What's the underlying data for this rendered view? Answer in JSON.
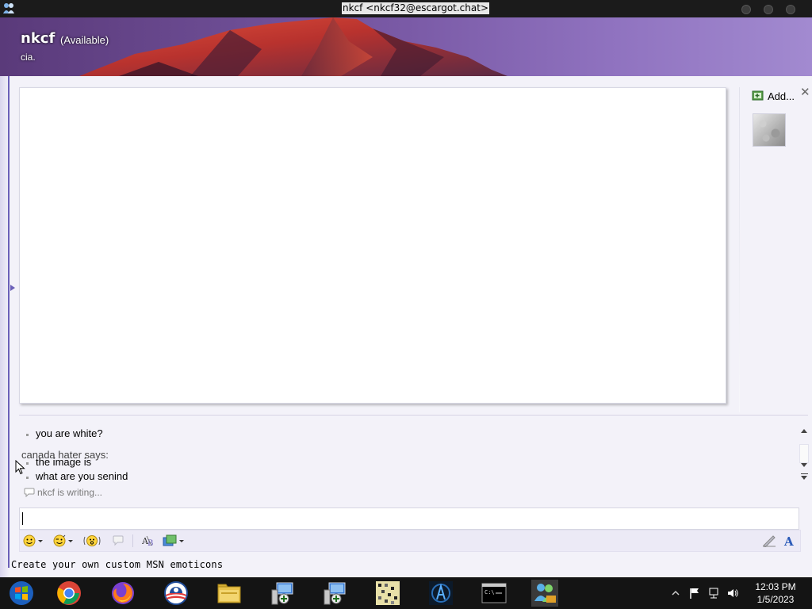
{
  "window": {
    "title": "nkcf <nkcf32@escargot.chat>"
  },
  "contact": {
    "name": "nkcf",
    "status": "(Available)",
    "personal_message": "cia."
  },
  "sidebar": {
    "add_label": "Add..."
  },
  "conversation": {
    "messages": [
      {
        "text": "you are white?"
      },
      {
        "sender": "canada hater says:"
      },
      {
        "text": "the image is"
      },
      {
        "text": "what are you senind"
      }
    ],
    "typing_status": "nkcf is writing..."
  },
  "input": {
    "value": ""
  },
  "footer": {
    "link_text": "Create your own custom MSN emoticons"
  },
  "taskbar": {
    "apps": [
      "windows-start-icon",
      "chrome-icon",
      "firefox-icon",
      "obama-logo-icon",
      "file-explorer-icon",
      "network-setup-icon",
      "network-setup-2-icon",
      "pixel-art-icon",
      "dark-app-icon",
      "command-prompt-icon",
      "msn-messenger-icon"
    ],
    "clock_time": "12:03 PM",
    "clock_date": "1/5/2023"
  },
  "colors": {
    "banner_purple": "#7a5aa6",
    "accent": "#6a5fb8",
    "taskbar_bg": "#141414"
  }
}
